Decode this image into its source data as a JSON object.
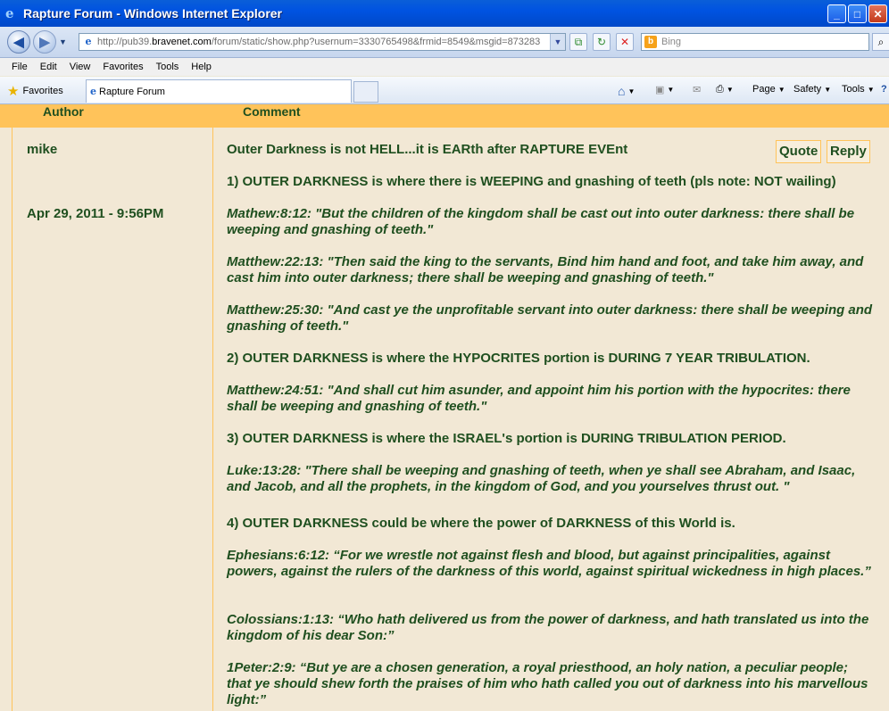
{
  "window": {
    "title": "Rapture Forum - Windows Internet Explorer",
    "controls": [
      "_",
      "□",
      "✕"
    ]
  },
  "address": {
    "prefix": "http://pub39.",
    "host": "bravenet.com",
    "path": "/forum/static/show.php?usernum=3330765498&frmid=8549&msgid=873283",
    "search_placeholder": "Bing"
  },
  "menu": [
    "File",
    "Edit",
    "View",
    "Favorites",
    "Tools",
    "Help"
  ],
  "tabs": {
    "favorites_label": "Favorites",
    "active_tab": "Rapture Forum"
  },
  "commandbar": {
    "page": "Page",
    "safety": "Safety",
    "tools": "Tools"
  },
  "table": {
    "author_header": "Author",
    "comment_header": "Comment"
  },
  "post": {
    "author": "mike",
    "date": "Apr 29, 2011 - 9:56PM",
    "quote_label": "Quote",
    "reply_label": "Reply",
    "subject": "Outer Darkness is not HELL...it is EARth after RAPTURE EVEnt",
    "paragraphs": [
      {
        "kind": "point",
        "text": "1) OUTER DARKNESS is where there is WEEPING and gnashing of teeth (pls note: NOT wailing)"
      },
      {
        "kind": "verse",
        "text": "Mathew:8:12: \"But the children of the kingdom shall be cast out into outer darkness: there shall be weeping and gnashing of teeth.\""
      },
      {
        "kind": "verse",
        "text": "Matthew:22:13: \"Then said the king to the servants, Bind him hand and foot, and take him away, and cast him into outer darkness; there shall be weeping and gnashing of teeth.\""
      },
      {
        "kind": "verse",
        "text": "Matthew:25:30: \"And cast ye the unprofitable servant into outer darkness: there shall be weeping and gnashing of teeth.\""
      },
      {
        "kind": "point",
        "text": "2) OUTER DARKNESS is where the HYPOCRITES portion is DURING 7 YEAR TRIBULATION."
      },
      {
        "kind": "verse",
        "text": "Matthew:24:51: \"And shall cut him asunder, and appoint him his portion with the hypocrites: there shall be weeping and gnashing of teeth.\""
      },
      {
        "kind": "point",
        "text": "3) OUTER DARKNESS is where the ISRAEL's portion is DURING TRIBULATION PERIOD."
      },
      {
        "kind": "verse",
        "text": "Luke:13:28: \"There shall be weeping and gnashing of teeth, when ye shall see Abraham, and Isaac, and Jacob, and all the prophets, in the kingdom of God, and you yourselves thrust out. \""
      },
      {
        "kind": "point",
        "text": "4) OUTER DARKNESS could be where the power of DARKNESS of this World is."
      },
      {
        "kind": "verse",
        "text": "Ephesians:6:12: “For we wrestle not against flesh and blood, but against principalities, against powers, against the rulers of the darkness of this world, against spiritual wickedness in high places.”"
      },
      {
        "kind": "verse",
        "text": "Colossians:1:13: “Who hath delivered us from the power of darkness, and hath translated us into the kingdom of his dear Son:”"
      },
      {
        "kind": "verse",
        "text": "1Peter:2:9: “But ye are a chosen generation, a royal priesthood, an holy nation, a peculiar people; that ye should shew forth the praises of him who hath called you out of darkness into his marvellous light:”"
      }
    ]
  }
}
